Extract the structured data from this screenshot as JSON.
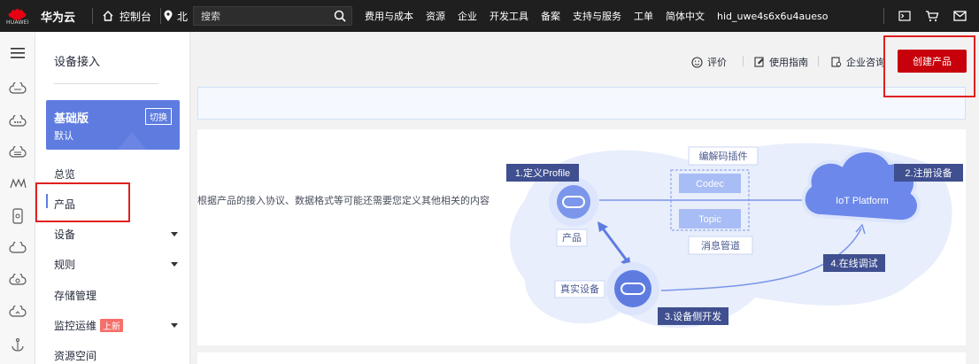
{
  "topbar": {
    "logo_text": "HUAWEI",
    "brand": "华为云",
    "console": "控制台",
    "region": "北",
    "search_placeholder": "搜索",
    "nav": [
      "费用与成本",
      "资源",
      "企业",
      "开发工具",
      "备案",
      "支持与服务",
      "工单",
      "简体中文"
    ],
    "user": "hid_uwe4s6x6u4aueso",
    "icons": [
      "terminal-icon",
      "cart-icon",
      "mail-icon"
    ]
  },
  "rail": {
    "icons": [
      "menu-icon",
      "cloud-icon",
      "cloud-icon",
      "cloud-icon",
      "m-icon",
      "phone-icon",
      "cloud-icon",
      "cloud-icon",
      "cloud-icon",
      "anchor-icon"
    ]
  },
  "sidebar": {
    "title": "设备接入",
    "edition": {
      "name": "基础版",
      "switch": "切换",
      "sub": "默认"
    },
    "items": [
      {
        "label": "总览",
        "caret": false
      },
      {
        "label": "产品",
        "caret": false,
        "active": true
      },
      {
        "label": "设备",
        "caret": true
      },
      {
        "label": "规则",
        "caret": true
      },
      {
        "label": "存储管理",
        "caret": false
      },
      {
        "label": "监控运维",
        "caret": true,
        "badge": "上新"
      },
      {
        "label": "资源空间",
        "caret": false
      }
    ]
  },
  "header": {
    "rate": "评价",
    "guide": "使用指南",
    "consult": "企业咨询",
    "create": "创建产品"
  },
  "main": {
    "description": "根据产品的接入协议、数据格式等可能还需要您定义其他相关的内容"
  },
  "diagram": {
    "step1": "1.定义Profile",
    "step2": "2.注册设备",
    "step3": "3.设备侧开发",
    "step4": "4.在线调试",
    "product": "产品",
    "real_device": "真实设备",
    "codec_plugin": "编解码插件",
    "codec": "Codec",
    "topic": "Topic",
    "msg_pipe": "消息管道",
    "platform": "IoT Platform"
  },
  "colors": {
    "accent": "#5e7ce0",
    "brand_red": "#c7000b",
    "topbar": "#1f1f1f",
    "step_tag": "#3f4f8f"
  }
}
